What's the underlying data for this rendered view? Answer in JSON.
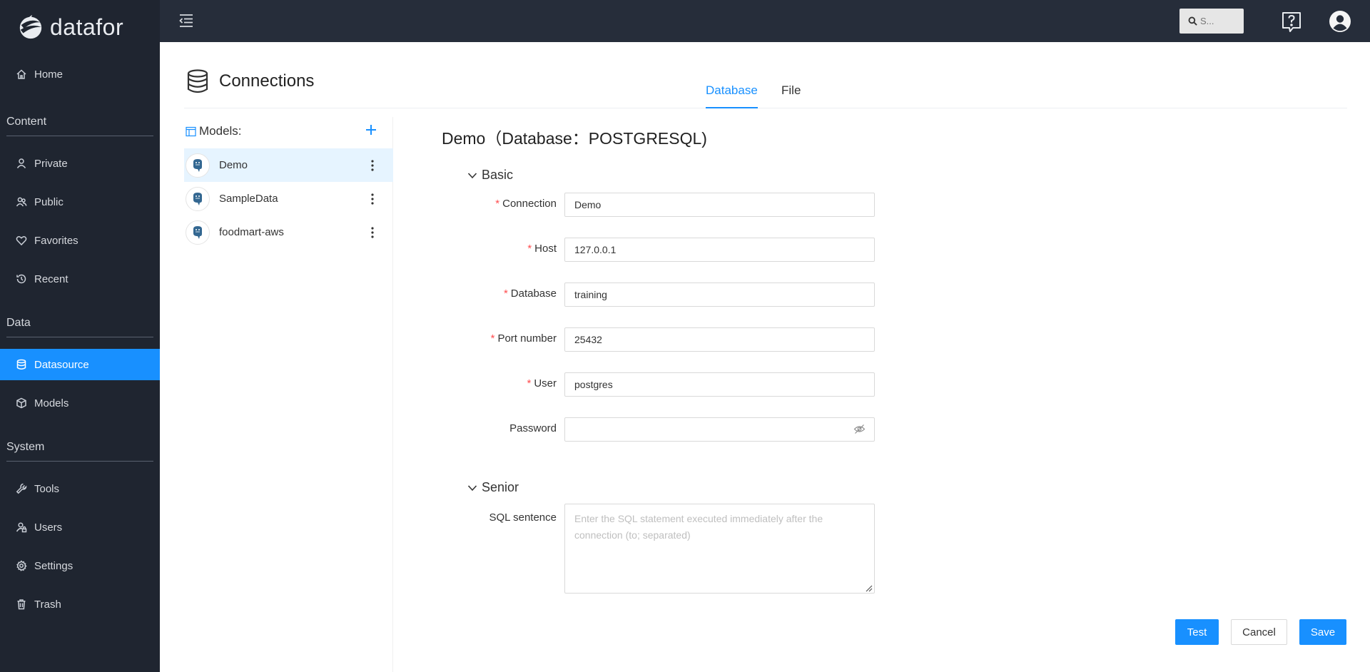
{
  "app": {
    "logo_text": "datafor"
  },
  "sidebar": {
    "items": [
      {
        "label": "Home",
        "icon": "home-icon"
      },
      {
        "label": "Private",
        "icon": "user-icon"
      },
      {
        "label": "Public",
        "icon": "users-icon"
      },
      {
        "label": "Favorites",
        "icon": "heart-icon"
      },
      {
        "label": "Recent",
        "icon": "history-icon"
      },
      {
        "label": "Datasource",
        "icon": "database-icon",
        "active": true
      },
      {
        "label": "Models",
        "icon": "cube-icon"
      },
      {
        "label": "Tools",
        "icon": "wrench-icon"
      },
      {
        "label": "Users",
        "icon": "user-lock-icon"
      },
      {
        "label": "Settings",
        "icon": "gear-icon"
      },
      {
        "label": "Trash",
        "icon": "trash-icon"
      }
    ],
    "sections": [
      "Content",
      "Data",
      "System"
    ]
  },
  "topbar": {
    "search_placeholder": "S..."
  },
  "page": {
    "title": "Connections"
  },
  "tabs": [
    {
      "label": "Database",
      "active": true
    },
    {
      "label": "File"
    }
  ],
  "models": {
    "header": "Models:",
    "items": [
      {
        "name": "Demo",
        "selected": true
      },
      {
        "name": "SampleData"
      },
      {
        "name": "foodmart-aws"
      }
    ]
  },
  "form": {
    "title": "Demo（Database：POSTGRESQL)",
    "basic_label": "Basic",
    "senior_label": "Senior",
    "fields": {
      "connection": {
        "label": "Connection",
        "value": "Demo",
        "required": true
      },
      "host": {
        "label": "Host",
        "value": "127.0.0.1",
        "required": true
      },
      "database": {
        "label": "Database",
        "value": "training",
        "required": true
      },
      "port": {
        "label": "Port number",
        "value": "25432",
        "required": true
      },
      "user": {
        "label": "User",
        "value": "postgres",
        "required": true
      },
      "password": {
        "label": "Password",
        "value": ""
      },
      "sql": {
        "label": "SQL sentence",
        "placeholder": "Enter the SQL statement executed immediately after the connection (to; separated)"
      }
    },
    "required_mark": "*"
  },
  "buttons": {
    "test": "Test",
    "cancel": "Cancel",
    "save": "Save"
  },
  "colors": {
    "accent": "#1890ff",
    "sidebar_bg": "#1f2530",
    "topbar_bg": "#262d3a",
    "required": "#ff4d4f"
  }
}
